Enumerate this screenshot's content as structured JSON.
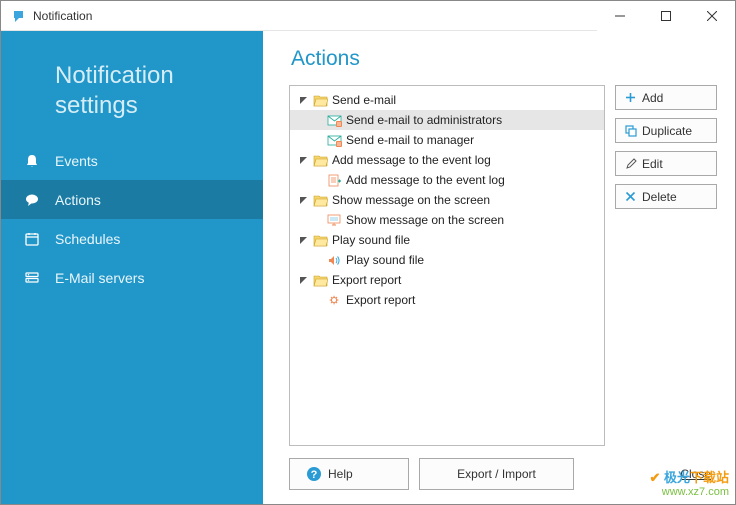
{
  "window": {
    "title": "Notification"
  },
  "sidebar": {
    "heading_line1": "Notification",
    "heading_line2": "settings",
    "items": [
      {
        "label": "Events"
      },
      {
        "label": "Actions"
      },
      {
        "label": "Schedules"
      },
      {
        "label": "E-Mail servers"
      }
    ]
  },
  "content": {
    "heading": "Actions",
    "tree": {
      "send_email": {
        "label": "Send e-mail",
        "child1": "Send e-mail to administrators",
        "child2": "Send e-mail to manager"
      },
      "event_log": {
        "label": "Add message to the event log",
        "child1": "Add message to the event log"
      },
      "screen": {
        "label": "Show message on the screen",
        "child1": "Show message on the screen"
      },
      "sound": {
        "label": "Play sound file",
        "child1": "Play sound file"
      },
      "export": {
        "label": "Export report",
        "child1": "Export report"
      }
    },
    "buttons": {
      "add": "Add",
      "duplicate": "Duplicate",
      "edit": "Edit",
      "delete": "Delete"
    },
    "bottom": {
      "help": "Help",
      "export_import": "Export / Import",
      "close": "Close"
    }
  },
  "watermark": {
    "line1a": "极光",
    "line1b": "下载站",
    "line2": "www.xz7.com"
  },
  "colors": {
    "sidebar_bg": "#2196c9",
    "sidebar_active": "#1b7ba3",
    "heading": "#2196c9"
  }
}
